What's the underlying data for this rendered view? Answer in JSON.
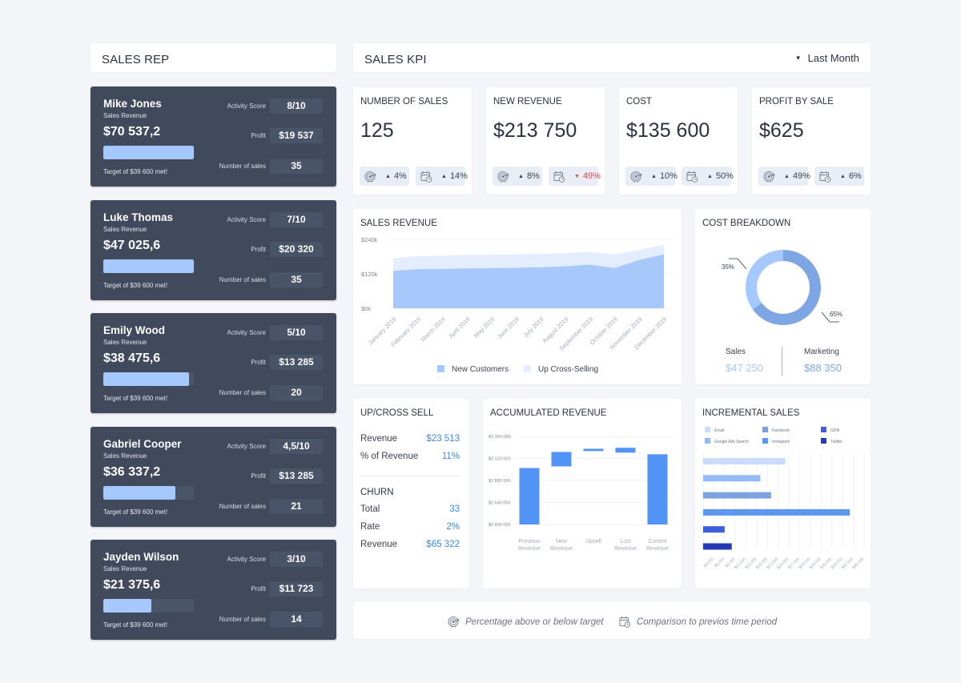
{
  "sidebar": {
    "title": "SALES REP",
    "reps": [
      {
        "name": "Mike Jones",
        "sub": "Sales Revenue",
        "revenue": "$70 537,2",
        "progress": 1.0,
        "target": "Target of $39 600 met!",
        "activity_label": "Activity Score",
        "activity": "8/10",
        "profit_label": "Profit",
        "profit": "$19 537",
        "sales_label": "Number of sales",
        "sales": "35"
      },
      {
        "name": "Luke Thomas",
        "sub": "Sales Revenue",
        "revenue": "$47 025,6",
        "progress": 1.0,
        "target": "Target of $39 600 met!",
        "activity_label": "Activity Score",
        "activity": "7/10",
        "profit_label": "Profit",
        "profit": "$20 320",
        "sales_label": "Number of sales",
        "sales": "35"
      },
      {
        "name": "Emily Wood",
        "sub": "Sales Revenue",
        "revenue": "$38 475,6",
        "progress": 0.95,
        "target": "Target of $39 600 met!",
        "activity_label": "Activity Score",
        "activity": "5/10",
        "profit_label": "Profit",
        "profit": "$13 285",
        "sales_label": "Number of sales",
        "sales": "20"
      },
      {
        "name": "Gabriel Cooper",
        "sub": "Sales Revenue",
        "revenue": "$36 337,2",
        "progress": 0.8,
        "target": "Target of $39 600 met!",
        "activity_label": "Activity Score",
        "activity": "4,5/10",
        "profit_label": "Profit",
        "profit": "$13 285",
        "sales_label": "Number of sales",
        "sales": "21"
      },
      {
        "name": "Jayden Wilson",
        "sub": "Sales Revenue",
        "revenue": "$21 375,6",
        "progress": 0.53,
        "target": "Target of $39 600 met!",
        "activity_label": "Activity Score",
        "activity": "3/10",
        "profit_label": "Profit",
        "profit": "$11 723",
        "sales_label": "Number of sales",
        "sales": "14"
      }
    ]
  },
  "header": {
    "title": "SALES KPI",
    "period": "Last Month",
    "period_icon": "caret-down-icon"
  },
  "kpis": [
    {
      "title": "NUMBER OF SALES",
      "value": "125",
      "target_pct": "4%",
      "target_dir": "up",
      "period_pct": "14%",
      "period_dir": "up"
    },
    {
      "title": "NEW REVENUE",
      "value": "$213 750",
      "target_pct": "8%",
      "target_dir": "up",
      "period_pct": "49%",
      "period_dir": "down"
    },
    {
      "title": "COST",
      "value": "$135 600",
      "target_pct": "10%",
      "target_dir": "up",
      "period_pct": "50%",
      "period_dir": "up"
    },
    {
      "title": "PROFIT BY SALE",
      "value": "$625",
      "target_pct": "49%",
      "target_dir": "up",
      "period_pct": "6%",
      "period_dir": "up"
    }
  ],
  "colors": {
    "accent": "#3f86ef",
    "negative": "#e64545",
    "rep_card": "#404a5c",
    "bar_fill": "#a5c8ff"
  },
  "up_cross": {
    "title": "UP/CROSS SELL",
    "rows": [
      {
        "label": "Revenue",
        "value": "$23 513"
      },
      {
        "label": "% of Revenue",
        "value": "11%"
      }
    ],
    "churn_title": "CHURN",
    "churn_rows": [
      {
        "label": "Total",
        "value": "33"
      },
      {
        "label": "Rate",
        "value": "2%"
      },
      {
        "label": "Revenue",
        "value": "$65 322"
      }
    ]
  },
  "footer": {
    "target_legend": "Percentage above or below target",
    "period_legend": "Comparison to previos time period"
  },
  "chart_data": [
    {
      "id": "sales_revenue",
      "type": "area",
      "title": "SALES REVENUE",
      "categories": [
        "January 2019",
        "February 2019",
        "March 2019",
        "April 2019",
        "May 2019",
        "June 2019",
        "July 2019",
        "August 2019",
        "September 2019",
        "October 2019",
        "November 2019",
        "December 2019"
      ],
      "series": [
        {
          "name": "New Customers",
          "color": "#a8c8fc",
          "values": [
            130,
            136,
            137,
            139,
            140,
            141,
            143,
            146,
            152,
            140,
            168,
            188
          ]
        },
        {
          "name": "Up Cross-Selling",
          "color": "#e3edfd",
          "values": [
            44,
            46,
            46,
            47,
            46,
            47,
            47,
            46,
            45,
            48,
            36,
            34
          ]
        }
      ],
      "stacked": true,
      "yticks": [
        "$0k",
        "$120k",
        "$240k"
      ],
      "ylim": [
        0,
        240
      ],
      "legend": "bottom"
    },
    {
      "id": "cost_breakdown",
      "type": "pie",
      "title": "COST BREAKDOWN",
      "donut": true,
      "slices": [
        {
          "name": "Sales",
          "pct": 35,
          "value": "$47 250",
          "color": "#a5c8ff"
        },
        {
          "name": "Marketing",
          "pct": 65,
          "value": "$88 350",
          "color": "#7ea5e4"
        }
      ],
      "labels": [
        "35%",
        "65%"
      ]
    },
    {
      "id": "accumulated_revenue",
      "type": "bar",
      "subtype": "waterfall",
      "title": "ACCUMULATED REVENUE",
      "categories": [
        "Previous Revenue",
        "New Revenue",
        "Upsell",
        "Lost Revenue",
        "Current Revenue"
      ],
      "bars": [
        {
          "start": 2400000,
          "end": 3015000
        },
        {
          "start": 3033000,
          "end": 3190000
        },
        {
          "start": 3200000,
          "end": 3225000
        },
        {
          "start": 3236000,
          "end": 3183000
        },
        {
          "start": 2400000,
          "end": 3165000
        }
      ],
      "yticks": [
        "$2 400 000",
        "$2 640 000",
        "$2 880 000",
        "$3 120 000",
        "$3 360 000"
      ],
      "ylim": [
        2400000,
        3360000
      ],
      "color": "#5294f6"
    },
    {
      "id": "incremental_sales",
      "type": "bar",
      "orientation": "horizontal",
      "title": "INCREMENTAL SALES",
      "series": [
        {
          "name": "Email",
          "value": 23000,
          "color": "#c9dcfb"
        },
        {
          "name": "Google Ads Search",
          "value": 16000,
          "color": "#94bbf5"
        },
        {
          "name": "Facebook",
          "value": 19000,
          "color": "#7ea2de"
        },
        {
          "name": "Instagram",
          "value": 41000,
          "color": "#5b98ee"
        },
        {
          "name": "GDN",
          "value": 6000,
          "color": "#3d5fdc"
        },
        {
          "name": "Twitter",
          "value": 8000,
          "color": "#2539b4"
        }
      ],
      "legend_order": [
        "Email",
        "Facebook",
        "GDN",
        "Google Ads Search",
        "Instagram",
        "Twitter"
      ],
      "xticks": [
        "$3,000",
        "$6,000",
        "$9,000",
        "$12,000",
        "$15,000",
        "$18,000",
        "$21,000",
        "$24,000",
        "$27,000",
        "$30,000",
        "$33,000",
        "$36,000",
        "$39,000",
        "$42,000",
        "$45,000"
      ],
      "xlim": [
        0,
        45000
      ],
      "legend": "top"
    }
  ]
}
